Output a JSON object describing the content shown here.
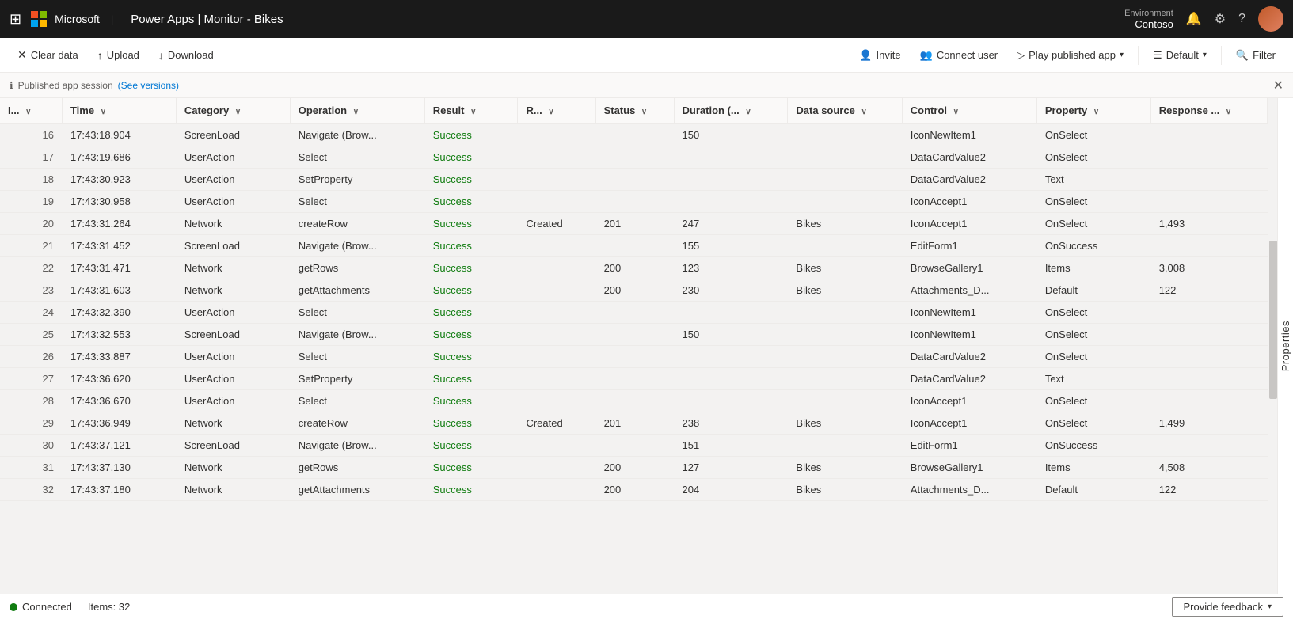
{
  "topbar": {
    "title": "Power Apps  |  Monitor - Bikes",
    "environment_label": "Environment",
    "environment_name": "Contoso"
  },
  "toolbar": {
    "clear_data": "Clear data",
    "upload": "Upload",
    "download": "Download",
    "invite": "Invite",
    "connect_user": "Connect user",
    "play_published_app": "Play published app",
    "default": "Default",
    "filter": "Filter"
  },
  "sessionbar": {
    "info_icon": "ℹ",
    "text": "Published app session",
    "link_text": "(See versions)"
  },
  "table": {
    "columns": [
      "I...",
      "Time",
      "Category",
      "Operation",
      "Result",
      "R...",
      "Status",
      "Duration (...",
      "Data source",
      "Control",
      "Property",
      "Response ..."
    ],
    "rows": [
      {
        "id": 16,
        "time": "17:43:18.904",
        "category": "ScreenLoad",
        "operation": "Navigate (Brow...",
        "result": "Success",
        "r": "",
        "status": "",
        "duration": "150",
        "datasource": "",
        "control": "IconNewItem1",
        "property": "OnSelect",
        "response": ""
      },
      {
        "id": 17,
        "time": "17:43:19.686",
        "category": "UserAction",
        "operation": "Select",
        "result": "Success",
        "r": "",
        "status": "",
        "duration": "",
        "datasource": "",
        "control": "DataCardValue2",
        "property": "OnSelect",
        "response": ""
      },
      {
        "id": 18,
        "time": "17:43:30.923",
        "category": "UserAction",
        "operation": "SetProperty",
        "result": "Success",
        "r": "",
        "status": "",
        "duration": "",
        "datasource": "",
        "control": "DataCardValue2",
        "property": "Text",
        "response": ""
      },
      {
        "id": 19,
        "time": "17:43:30.958",
        "category": "UserAction",
        "operation": "Select",
        "result": "Success",
        "r": "",
        "status": "",
        "duration": "",
        "datasource": "",
        "control": "IconAccept1",
        "property": "OnSelect",
        "response": ""
      },
      {
        "id": 20,
        "time": "17:43:31.264",
        "category": "Network",
        "operation": "createRow",
        "result": "Success",
        "r": "Created",
        "status": "201",
        "duration": "247",
        "datasource": "Bikes",
        "control": "IconAccept1",
        "property": "OnSelect",
        "response": "1,493"
      },
      {
        "id": 21,
        "time": "17:43:31.452",
        "category": "ScreenLoad",
        "operation": "Navigate (Brow...",
        "result": "Success",
        "r": "",
        "status": "",
        "duration": "155",
        "datasource": "",
        "control": "EditForm1",
        "property": "OnSuccess",
        "response": ""
      },
      {
        "id": 22,
        "time": "17:43:31.471",
        "category": "Network",
        "operation": "getRows",
        "result": "Success",
        "r": "",
        "status": "200",
        "duration": "123",
        "datasource": "Bikes",
        "control": "BrowseGallery1",
        "property": "Items",
        "response": "3,008"
      },
      {
        "id": 23,
        "time": "17:43:31.603",
        "category": "Network",
        "operation": "getAttachments",
        "result": "Success",
        "r": "",
        "status": "200",
        "duration": "230",
        "datasource": "Bikes",
        "control": "Attachments_D...",
        "property": "Default",
        "response": "122"
      },
      {
        "id": 24,
        "time": "17:43:32.390",
        "category": "UserAction",
        "operation": "Select",
        "result": "Success",
        "r": "",
        "status": "",
        "duration": "",
        "datasource": "",
        "control": "IconNewItem1",
        "property": "OnSelect",
        "response": ""
      },
      {
        "id": 25,
        "time": "17:43:32.553",
        "category": "ScreenLoad",
        "operation": "Navigate (Brow...",
        "result": "Success",
        "r": "",
        "status": "",
        "duration": "150",
        "datasource": "",
        "control": "IconNewItem1",
        "property": "OnSelect",
        "response": ""
      },
      {
        "id": 26,
        "time": "17:43:33.887",
        "category": "UserAction",
        "operation": "Select",
        "result": "Success",
        "r": "",
        "status": "",
        "duration": "",
        "datasource": "",
        "control": "DataCardValue2",
        "property": "OnSelect",
        "response": ""
      },
      {
        "id": 27,
        "time": "17:43:36.620",
        "category": "UserAction",
        "operation": "SetProperty",
        "result": "Success",
        "r": "",
        "status": "",
        "duration": "",
        "datasource": "",
        "control": "DataCardValue2",
        "property": "Text",
        "response": ""
      },
      {
        "id": 28,
        "time": "17:43:36.670",
        "category": "UserAction",
        "operation": "Select",
        "result": "Success",
        "r": "",
        "status": "",
        "duration": "",
        "datasource": "",
        "control": "IconAccept1",
        "property": "OnSelect",
        "response": ""
      },
      {
        "id": 29,
        "time": "17:43:36.949",
        "category": "Network",
        "operation": "createRow",
        "result": "Success",
        "r": "Created",
        "status": "201",
        "duration": "238",
        "datasource": "Bikes",
        "control": "IconAccept1",
        "property": "OnSelect",
        "response": "1,499"
      },
      {
        "id": 30,
        "time": "17:43:37.121",
        "category": "ScreenLoad",
        "operation": "Navigate (Brow...",
        "result": "Success",
        "r": "",
        "status": "",
        "duration": "151",
        "datasource": "",
        "control": "EditForm1",
        "property": "OnSuccess",
        "response": ""
      },
      {
        "id": 31,
        "time": "17:43:37.130",
        "category": "Network",
        "operation": "getRows",
        "result": "Success",
        "r": "",
        "status": "200",
        "duration": "127",
        "datasource": "Bikes",
        "control": "BrowseGallery1",
        "property": "Items",
        "response": "4,508"
      },
      {
        "id": 32,
        "time": "17:43:37.180",
        "category": "Network",
        "operation": "getAttachments",
        "result": "Success",
        "r": "",
        "status": "200",
        "duration": "204",
        "datasource": "Bikes",
        "control": "Attachments_D...",
        "property": "Default",
        "response": "122"
      }
    ]
  },
  "statusbar": {
    "connected_text": "Connected",
    "items_text": "Items: 32",
    "feedback_text": "Provide feedback"
  }
}
